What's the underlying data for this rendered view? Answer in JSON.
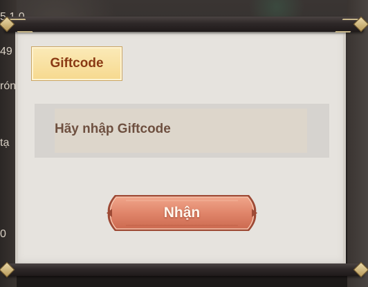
{
  "dialog": {
    "tab_label": "Giftcode",
    "input_placeholder": "Hãy nhập Giftcode",
    "input_value": "",
    "submit_label": "Nhận"
  },
  "background": {
    "left_fragments": [
      "5.1.0",
      "49",
      "rón",
      "tạ",
      "0"
    ]
  },
  "colors": {
    "paper": "#e6e3de",
    "tab_fill": "#f6d98e",
    "tab_text": "#8a3a14",
    "input_fill": "#ddd6cb",
    "input_text": "#6e5040",
    "button_fill": "#e0856a",
    "button_text": "#fff7ee",
    "rod": "#2e2828"
  },
  "icons": {
    "rod_caps": "diamond-cap-icon",
    "rod_ornaments": "chevron-ornament-icon"
  }
}
